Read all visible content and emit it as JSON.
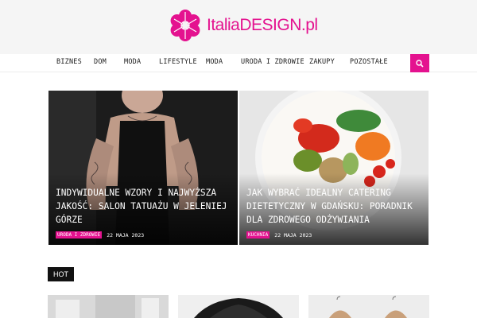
{
  "site": {
    "name": "ItaliaDESIGN.pl",
    "brand_color": "#e4128f",
    "logo_icon": "flower-icon"
  },
  "nav": {
    "items": [
      "BIZNES",
      "DOM",
      "MODA",
      "LIFESTYLE",
      "MODA",
      "URODA I ZDROWIE",
      "ZAKUPY",
      "POZOSTAŁE"
    ],
    "search_icon": "search-icon"
  },
  "featured": [
    {
      "title": "INDYWIDUALNE WZORY I NAJWYŻSZA JAKOŚĆ: SALON TATUAŻU W JELENIEJ GÓRZE",
      "category": "URODA I ZDROWIE",
      "date": "22 MAJA 2023"
    },
    {
      "title": "JAK WYBRAĆ IDEALNY CATERING DIETETYCZNY W GDAŃSKU: PORADNIK DLA ZDROWEGO ODŻYWIANIA",
      "category": "KUCHNIA",
      "date": "22 MAJA 2023"
    }
  ],
  "hot": {
    "label": "HOT"
  }
}
